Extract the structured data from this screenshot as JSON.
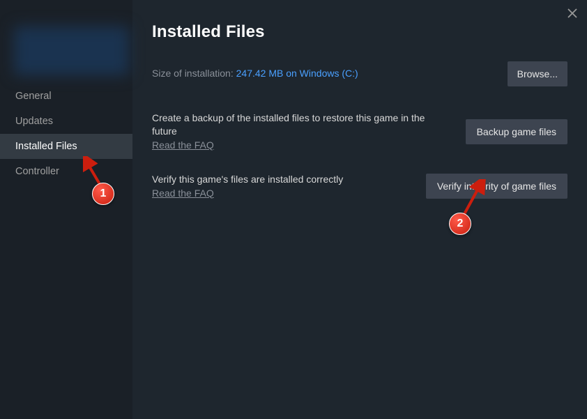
{
  "sidebar": {
    "items": [
      {
        "label": "General",
        "active": false
      },
      {
        "label": "Updates",
        "active": false
      },
      {
        "label": "Installed Files",
        "active": true
      },
      {
        "label": "Controller",
        "active": false
      }
    ]
  },
  "main": {
    "title": "Installed Files",
    "size_label": "Size of installation: ",
    "size_value": "247.42 MB on Windows (C:)",
    "browse_label": "Browse...",
    "backup": {
      "desc": "Create a backup of the installed files to restore this game in the future",
      "faq": "Read the FAQ",
      "button": "Backup game files"
    },
    "verify": {
      "desc": "Verify this game's files are installed correctly",
      "faq": "Read the FAQ",
      "button": "Verify integrity of game files"
    }
  },
  "annotations": {
    "badge1": "1",
    "badge2": "2"
  }
}
